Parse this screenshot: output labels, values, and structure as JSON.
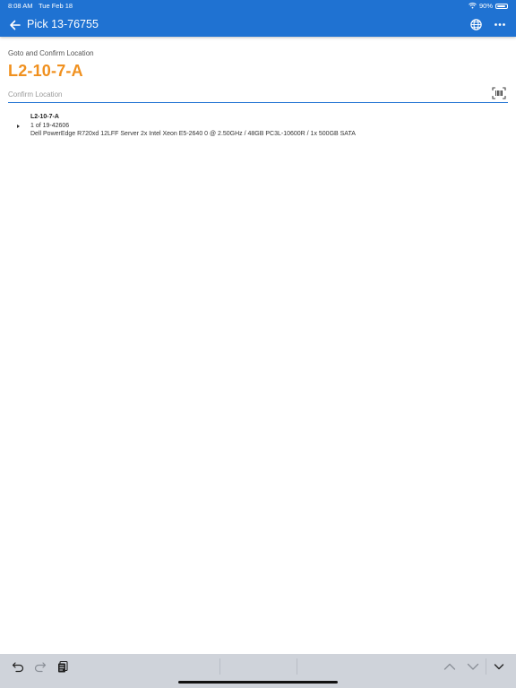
{
  "status_bar": {
    "time": "8:08 AM",
    "date": "Tue Feb 18",
    "battery": "90%",
    "battery_level": 0.9
  },
  "header": {
    "title": "Pick 13-76755",
    "bg_color": "#1f72d2"
  },
  "main": {
    "subtitle": "Goto and Confirm Location",
    "location": "L2-10-7-A",
    "location_color": "#f0901e",
    "confirm_placeholder": "Confirm Location",
    "confirm_value": ""
  },
  "items": [
    {
      "location": "L2-10-7-A",
      "quantity": "1 of 19-42606",
      "description": "Dell PowerEdge R720xd 12LFF Server 2x Intel Xeon E5-2640 0 @ 2.50GHz / 48GB PC3L-10600R / 1x 500GB SATA"
    }
  ],
  "icons": {
    "back": "arrow-left-icon",
    "globe": "globe-icon",
    "more": "more-horizontal-icon",
    "barcode": "barcode-scan-icon",
    "undo": "undo-icon",
    "redo": "redo-icon",
    "paste": "clipboard-icon",
    "prev": "chevron-up-icon",
    "next": "chevron-down-icon",
    "dismiss": "keyboard-dismiss-icon"
  }
}
